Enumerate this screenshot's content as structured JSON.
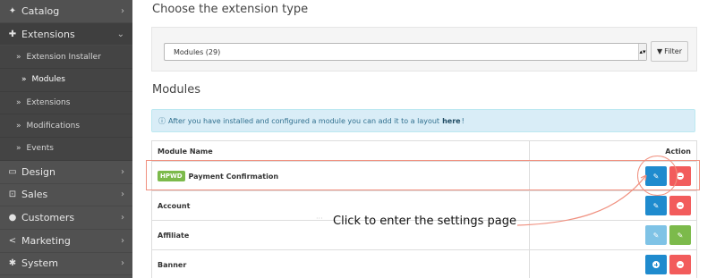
{
  "sidebar": {
    "items": [
      {
        "icon": "tag-icon",
        "glyph": "✦",
        "label": "Catalog"
      },
      {
        "icon": "puzzle-icon",
        "glyph": "✚",
        "label": "Extensions"
      },
      {
        "icon": "monitor-icon",
        "glyph": "▭",
        "label": "Design"
      },
      {
        "icon": "cart-icon",
        "glyph": "⊡",
        "label": "Sales"
      },
      {
        "icon": "user-icon",
        "glyph": "●",
        "label": "Customers"
      },
      {
        "icon": "share-icon",
        "glyph": "<",
        "label": "Marketing"
      },
      {
        "icon": "gear-icon",
        "glyph": "✱",
        "label": "System"
      }
    ],
    "submenu": [
      {
        "label": "Extension Installer"
      },
      {
        "label": "Modules"
      },
      {
        "label": "Extensions"
      },
      {
        "label": "Modifications"
      },
      {
        "label": "Events"
      }
    ]
  },
  "main": {
    "type_title": "Choose the extension type",
    "select_value": "Modules (29)",
    "filter_label": "Filter",
    "modules_title": "Modules",
    "info_text": "After you have installed and configured a module you can add it to a layout",
    "info_link": "here",
    "info_end": "!",
    "table": {
      "headers": {
        "name": "Module Name",
        "action": "Action"
      },
      "rows": [
        {
          "badge": "HPWD",
          "name": "Payment Confirmation"
        },
        {
          "name": "Account"
        },
        {
          "name": "Affiliate"
        },
        {
          "name": "Banner"
        }
      ]
    }
  },
  "annotation": {
    "text": "Click to enter the settings page",
    "ghost": "···"
  },
  "colors": {
    "sidebar_bg": "#515151",
    "primary": "#1f8bce",
    "danger": "#f25c5c",
    "success": "#7cba4b",
    "info_bg": "#d9edf7",
    "annotation": "#f0907f"
  }
}
